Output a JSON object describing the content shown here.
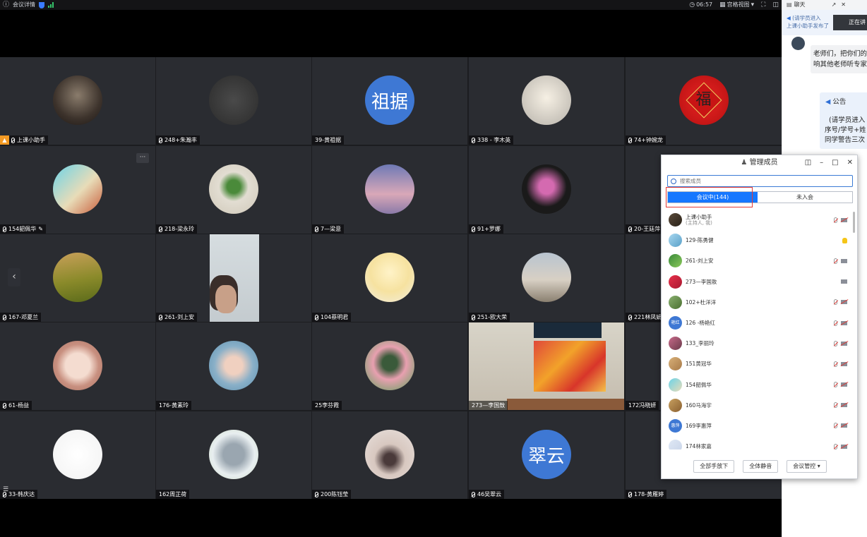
{
  "topbar": {
    "meeting_info": "会议详情",
    "time": "06:57",
    "view_mode": "宫格视图"
  },
  "tiles": [
    {
      "label": "上课小助手",
      "host": true,
      "avatar": "photo"
    },
    {
      "label": "248+朱瀚丰",
      "avatar": "photo"
    },
    {
      "label": "39-黄祖据",
      "avatar_text": "祖据"
    },
    {
      "label": "338 - 李木英",
      "avatar": "photo"
    },
    {
      "label": "74+钟婉龙",
      "avatar": "photo"
    },
    {
      "label": "154韶佩华",
      "avatar": "photo"
    },
    {
      "label": "218-梁永玲",
      "avatar": "photo"
    },
    {
      "label": "7—梁意",
      "avatar": "photo"
    },
    {
      "label": "91+罗娜",
      "avatar": "photo"
    },
    {
      "label": "20-王廷萍",
      "avatar": "photo"
    },
    {
      "label": "167-邓夏兰",
      "avatar": "photo"
    },
    {
      "label": "261-刘上安",
      "avatar": "video"
    },
    {
      "label": "104蔡明君",
      "avatar": "photo"
    },
    {
      "label": "251-欧大荣",
      "avatar": "photo"
    },
    {
      "label": "221林凤娟",
      "avatar": "photo"
    },
    {
      "label": "61-杨益",
      "avatar": "photo"
    },
    {
      "label": "176-黄素玲",
      "avatar": "photo"
    },
    {
      "label": "25李芬霞",
      "avatar": "photo"
    },
    {
      "label": "273—李国敖",
      "avatar": "video"
    },
    {
      "label": "172冯晓妍",
      "avatar": "photo"
    },
    {
      "label": "33-韩庆达",
      "avatar": "photo"
    },
    {
      "label": "162周芷荷",
      "avatar": "photo"
    },
    {
      "label": "200陈钰莹",
      "avatar": "photo"
    },
    {
      "label": "46吴翠云",
      "avatar_text": "翠云"
    },
    {
      "label": "178-黄雁婷",
      "avatar": "photo"
    }
  ],
  "chat": {
    "title": "聊天",
    "notice_line1": "(请学员进入",
    "notice_line2": "上课小助手发布了",
    "message": "老师们，把你们的",
    "message2": "响其他老师听专家",
    "announce_title": "公告",
    "announce1": "(请学员进入",
    "announce2": "序号/学号+姓",
    "announce3": "同学警告三次",
    "live_label": "正在讲"
  },
  "member_panel": {
    "title": "管理成员",
    "search_placeholder": "搜索成员",
    "tab_in": "会议中(144)",
    "tab_out": "未入会",
    "members": [
      {
        "name": "上课小助手",
        "sub": "(主持人, 我)",
        "mic": "off",
        "cam": "off"
      },
      {
        "name": "129-陈勇健",
        "hand": true
      },
      {
        "name": "261-刘上安",
        "mic": "off",
        "cam": "on"
      },
      {
        "name": "273—李国敖",
        "cam": "on"
      },
      {
        "name": "102+杜洋洋",
        "mic": "off",
        "cam": "off"
      },
      {
        "name": "126 -杨艳红",
        "avatar_text": "艳红",
        "mic": "off",
        "cam": "off"
      },
      {
        "name": "133_李丽玲",
        "mic": "off",
        "cam": "off"
      },
      {
        "name": "151黄冠华",
        "mic": "off",
        "cam": "off"
      },
      {
        "name": "154韶佩华",
        "mic": "off",
        "cam": "off"
      },
      {
        "name": "160马海宇",
        "mic": "off",
        "cam": "off"
      },
      {
        "name": "169李惠萍",
        "avatar_text": "惠萍",
        "mic": "off",
        "cam": "off"
      },
      {
        "name": "174林家嘉",
        "mic": "off",
        "cam": "off"
      }
    ],
    "btn_hands_down": "全部手放下",
    "btn_mute_all": "全体静音",
    "btn_control": "会议管控"
  }
}
